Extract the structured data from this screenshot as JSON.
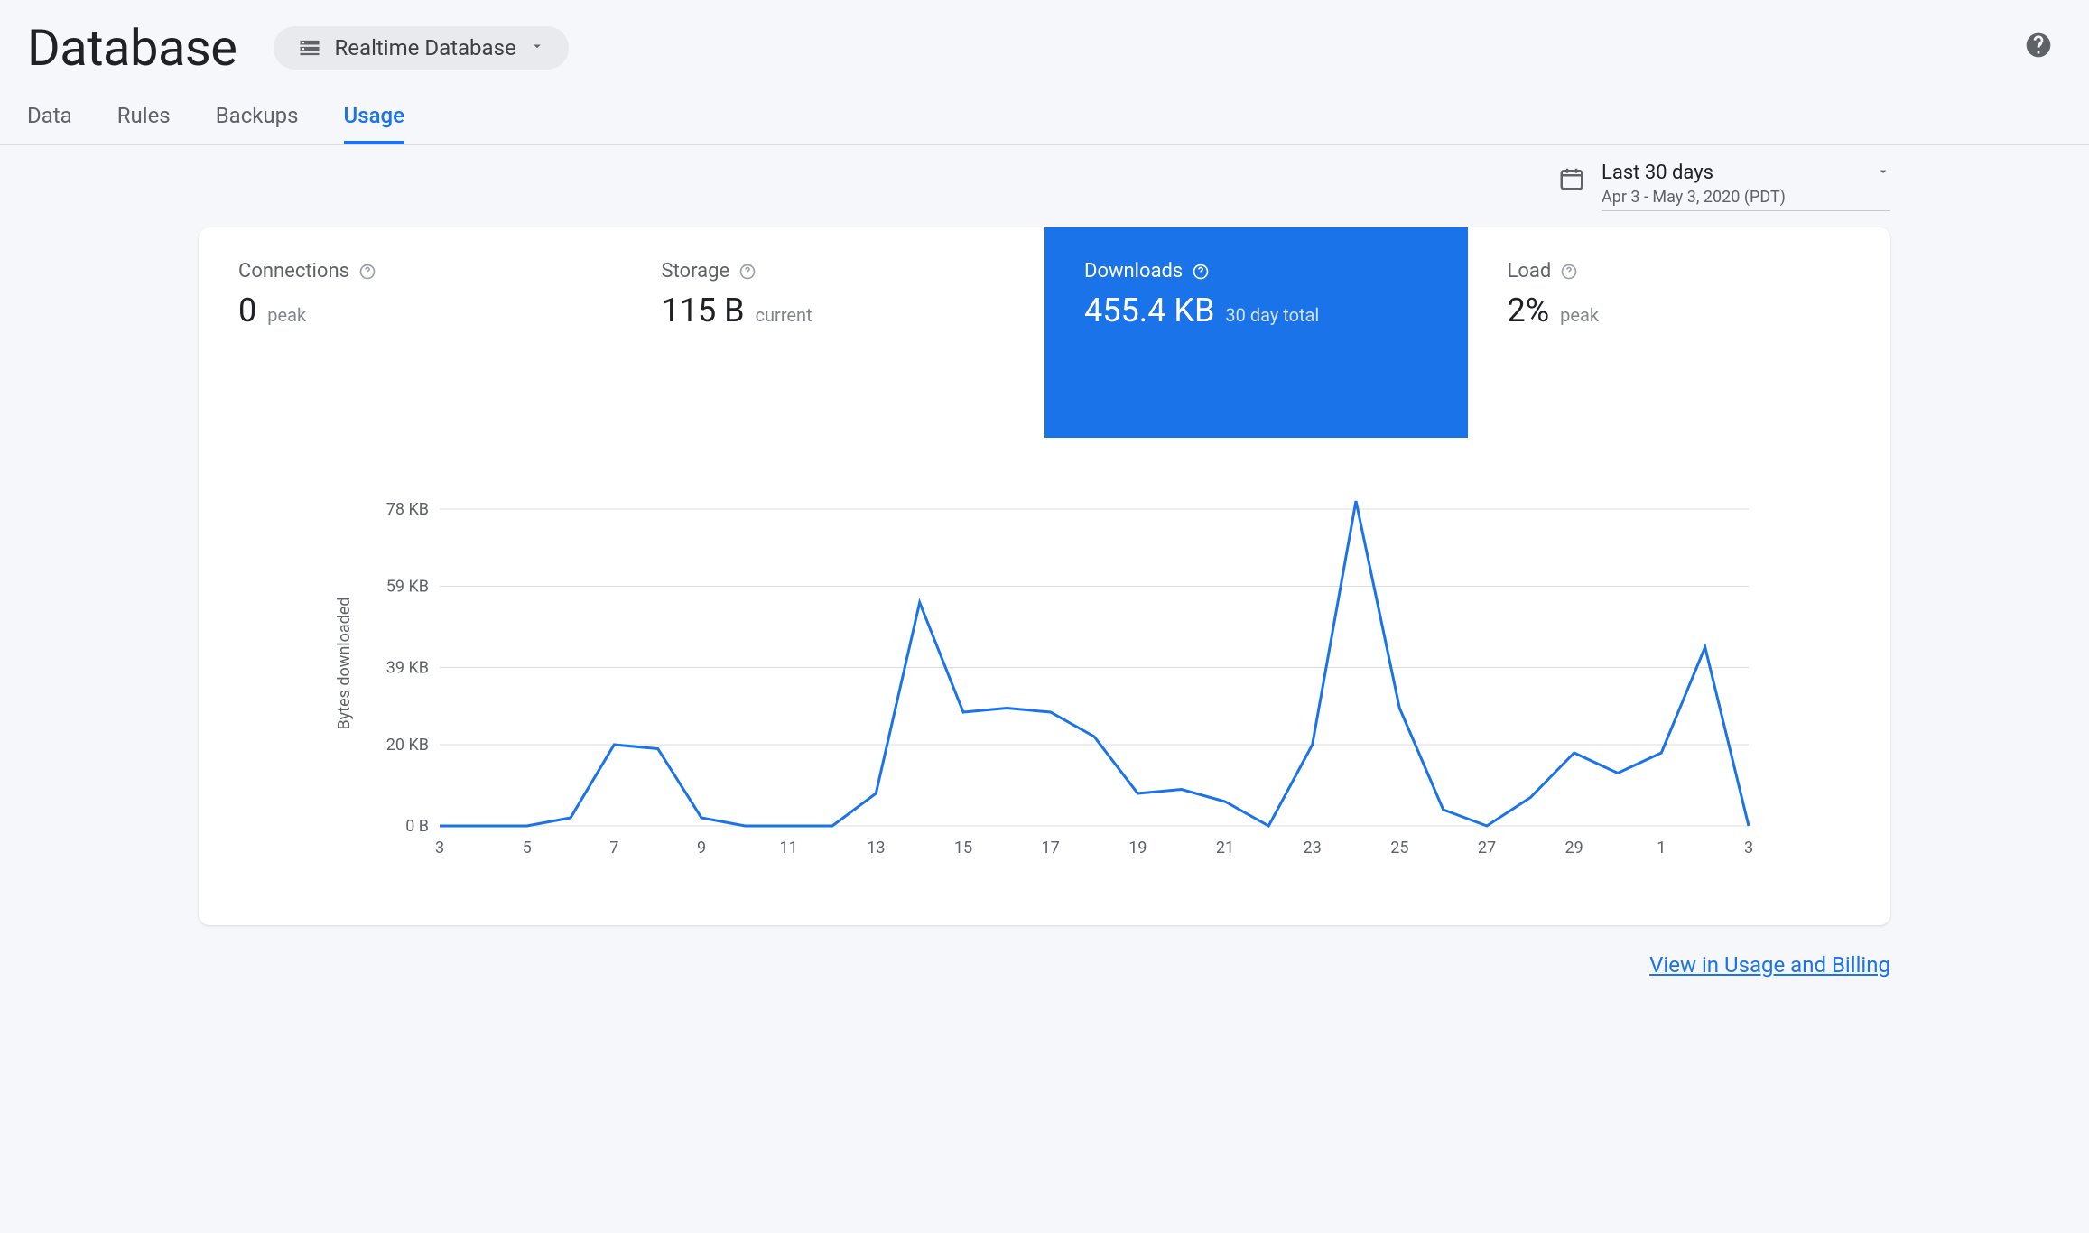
{
  "header": {
    "title": "Database",
    "selector_label": "Realtime Database"
  },
  "tabs": [
    {
      "label": "Data",
      "active": false
    },
    {
      "label": "Rules",
      "active": false
    },
    {
      "label": "Backups",
      "active": false
    },
    {
      "label": "Usage",
      "active": true
    }
  ],
  "date_range": {
    "label": "Last 30 days",
    "sub": "Apr 3 - May 3, 2020 (PDT)"
  },
  "metrics": {
    "connections": {
      "title": "Connections",
      "value": "0",
      "suffix": "peak"
    },
    "storage": {
      "title": "Storage",
      "value": "115 B",
      "suffix": "current"
    },
    "downloads": {
      "title": "Downloads",
      "value": "455.4 KB",
      "suffix": "30 day total"
    },
    "load": {
      "title": "Load",
      "value": "2%",
      "suffix": "peak"
    }
  },
  "footer_link": "View in Usage and Billing",
  "chart_data": {
    "type": "line",
    "title": "",
    "xlabel": "",
    "ylabel": "Bytes downloaded",
    "y_ticks": [
      "0 B",
      "20 KB",
      "39 KB",
      "59 KB",
      "78 KB"
    ],
    "ylim": [
      0,
      80
    ],
    "x_tick_labels": [
      "3",
      "5",
      "7",
      "9",
      "11",
      "13",
      "15",
      "17",
      "19",
      "21",
      "23",
      "25",
      "27",
      "29",
      "1",
      "3"
    ],
    "categories": [
      3,
      4,
      5,
      6,
      7,
      8,
      9,
      10,
      11,
      12,
      13,
      14,
      15,
      16,
      17,
      18,
      19,
      20,
      21,
      22,
      23,
      24,
      25,
      26,
      27,
      28,
      29,
      30,
      1,
      2,
      3
    ],
    "values": [
      0,
      0,
      0,
      2,
      20,
      19,
      2,
      0,
      0,
      0,
      8,
      55,
      28,
      29,
      28,
      22,
      8,
      9,
      6,
      0,
      20,
      80,
      29,
      4,
      0,
      7,
      18,
      13,
      18,
      44,
      0
    ]
  }
}
